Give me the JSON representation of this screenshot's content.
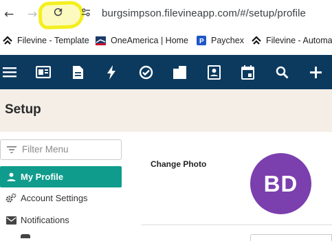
{
  "browser": {
    "url": "burgsimpson.filevineapp.com/#/setup/profile",
    "bookmarks": [
      {
        "label": "Filevine - Template",
        "icon": "filevine-icon"
      },
      {
        "label": "OneAmerica | Home",
        "icon": "oneamerica-icon"
      },
      {
        "label": "Paychex",
        "icon": "paychex-icon"
      },
      {
        "label": "Filevine - Automat",
        "icon": "filevine-icon"
      }
    ],
    "highlight_color": "#f3ef1f"
  },
  "header": {
    "background": "#0c3a5f",
    "icons": [
      "menu-icon",
      "card-icon",
      "document-icon",
      "lightning-icon",
      "check-circle-icon",
      "folder-icon",
      "contact-icon",
      "calendar-icon",
      "search-icon",
      "plus-icon"
    ]
  },
  "page": {
    "title": "Setup"
  },
  "sidebar": {
    "filter_placeholder": "Filter Menu",
    "items": [
      {
        "label": "My Profile",
        "icon": "person-icon",
        "active": true
      },
      {
        "label": "Account Settings",
        "icon": "gears-icon"
      },
      {
        "label": "Notifications",
        "icon": "envelope-icon"
      }
    ],
    "active_color": "#0f9c8d"
  },
  "main": {
    "change_photo_label": "Change Photo",
    "avatar_initials": "BD",
    "avatar_color": "#7b3fae"
  }
}
